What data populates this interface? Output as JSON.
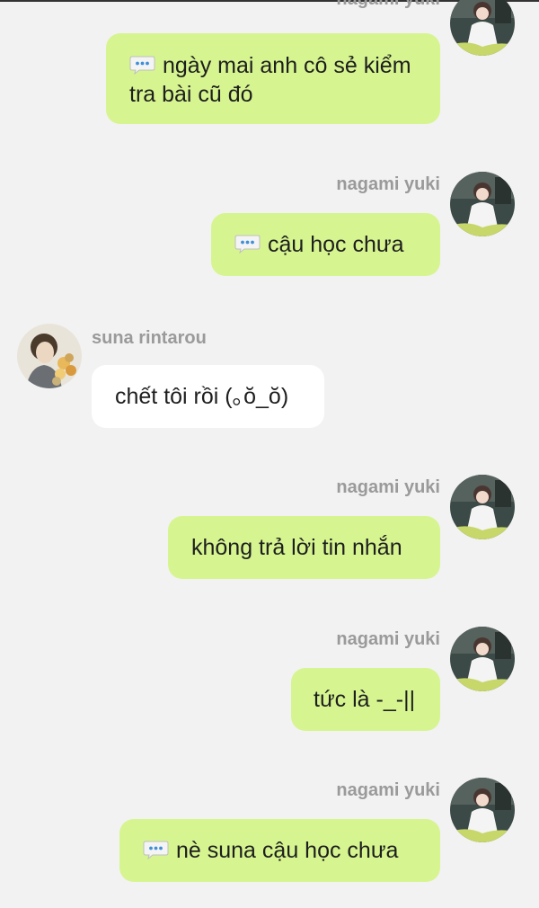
{
  "colors": {
    "background": "#f2f2f2",
    "outgoing_bubble": "#d6f590",
    "incoming_bubble": "#ffffff",
    "name_text": "#9a9a9a"
  },
  "messages": [
    {
      "sender": "nagami yuki",
      "side": "right",
      "has_icon": true,
      "icon": "speech-bubble-icon",
      "text": "ngày mai anh cô sẻ kiểm tra bài cũ đó"
    },
    {
      "sender": "nagami yuki",
      "side": "right",
      "has_icon": true,
      "icon": "speech-bubble-icon",
      "text": "cậu học chưa"
    },
    {
      "sender": "suna rintarou",
      "side": "left",
      "has_icon": false,
      "text": "chết tôi rồi (｡ŏ_ŏ)"
    },
    {
      "sender": "nagami yuki",
      "side": "right",
      "has_icon": false,
      "text": "không trả lời tin nhắn"
    },
    {
      "sender": "nagami yuki",
      "side": "right",
      "has_icon": false,
      "text": "tức là -_-||"
    },
    {
      "sender": "nagami yuki",
      "side": "right",
      "has_icon": true,
      "icon": "speech-bubble-icon",
      "text": "nè suna cậu học chưa"
    }
  ]
}
